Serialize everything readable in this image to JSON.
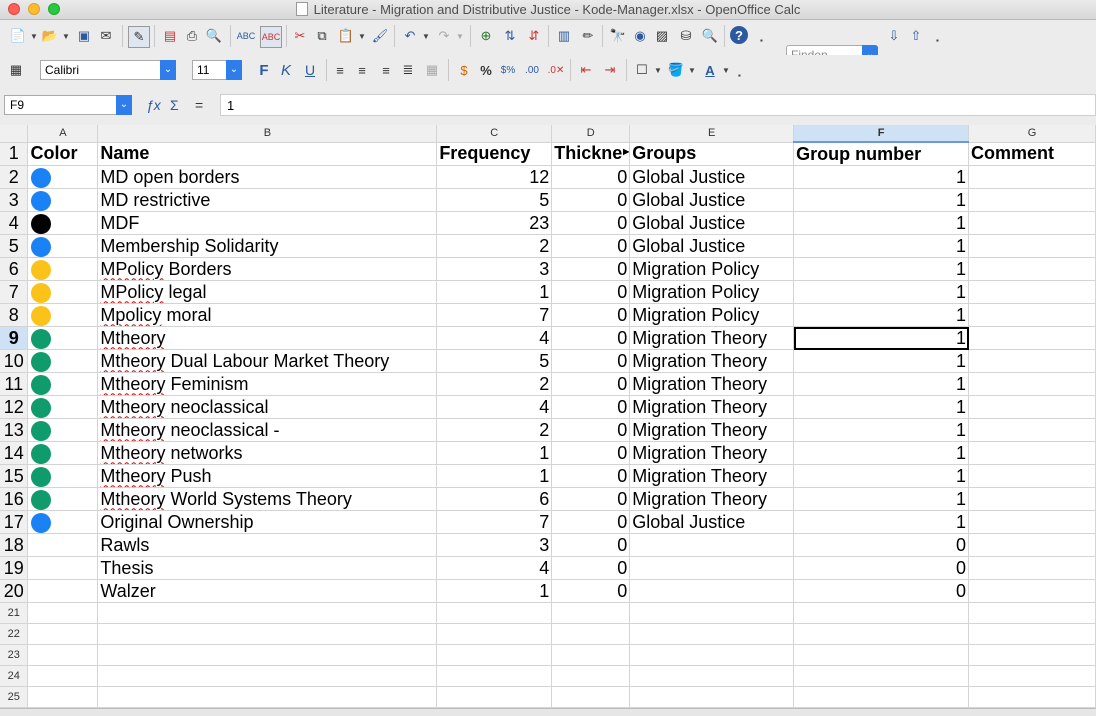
{
  "window": {
    "title": "Literature - Migration and Distributive Justice - Kode-Manager.xlsx - OpenOffice Calc"
  },
  "toolbar": {
    "find_placeholder": "Finden",
    "font_name": "Calibri",
    "font_size": "11"
  },
  "formula_bar": {
    "cell_ref": "F9",
    "content": "1"
  },
  "sheet": {
    "columns": [
      "A",
      "B",
      "C",
      "D",
      "E",
      "F",
      "G"
    ],
    "active_column": "F",
    "active_row": 9,
    "header_row": {
      "color": "Color",
      "name": "Name",
      "frequency": "Frequency",
      "thickness": "Thickne",
      "groups": "Groups",
      "group_number": "Group number",
      "comment": "Comment"
    },
    "rows": [
      {
        "row": "2",
        "color": "#1a82f5",
        "name": "MD open borders",
        "frequency": "12",
        "thickness": "0",
        "groups": "Global Justice",
        "group_number": "1"
      },
      {
        "row": "3",
        "color": "#1a82f5",
        "name": "MD restrictive",
        "frequency": "5",
        "thickness": "0",
        "groups": "Global Justice",
        "group_number": "1"
      },
      {
        "row": "4",
        "color": "#000000",
        "name": "MDF",
        "frequency": "23",
        "thickness": "0",
        "groups": "Global Justice",
        "group_number": "1"
      },
      {
        "row": "5",
        "color": "#1a82f5",
        "name": "Membership Solidarity",
        "frequency": "2",
        "thickness": "0",
        "groups": "Global Justice",
        "group_number": "1"
      },
      {
        "row": "6",
        "color": "#fbc31a",
        "name_prefix": "MPolicy",
        "name_suffix": " Borders",
        "frequency": "3",
        "thickness": "0",
        "groups": "Migration Policy",
        "group_number": "1"
      },
      {
        "row": "7",
        "color": "#fbc31a",
        "name_prefix": "MPolicy",
        "name_suffix": " legal",
        "frequency": "1",
        "thickness": "0",
        "groups": "Migration Policy",
        "group_number": "1"
      },
      {
        "row": "8",
        "color": "#fbc31a",
        "name_prefix": "Mpolicy",
        "name_suffix": " moral",
        "frequency": "7",
        "thickness": "0",
        "groups": "Migration Policy",
        "group_number": "1"
      },
      {
        "row": "9",
        "color": "#0f9b6b",
        "name_prefix": "Mtheory",
        "name_suffix": "",
        "frequency": "4",
        "thickness": "0",
        "groups": "Migration Theory",
        "group_number": "1"
      },
      {
        "row": "10",
        "color": "#0f9b6b",
        "name_prefix": "Mtheory",
        "name_suffix": " Dual Labour Market Theory",
        "frequency": "5",
        "thickness": "0",
        "groups": "Migration Theory",
        "group_number": "1"
      },
      {
        "row": "11",
        "color": "#0f9b6b",
        "name_prefix": "Mtheory",
        "name_suffix": " Feminism",
        "frequency": "2",
        "thickness": "0",
        "groups": "Migration Theory",
        "group_number": "1"
      },
      {
        "row": "12",
        "color": "#0f9b6b",
        "name_prefix": "Mtheory",
        "name_suffix": " neoclassical",
        "frequency": "4",
        "thickness": "0",
        "groups": "Migration Theory",
        "group_number": "1"
      },
      {
        "row": "13",
        "color": "#0f9b6b",
        "name_prefix": "Mtheory",
        "name_suffix": " neoclassical -",
        "frequency": "2",
        "thickness": "0",
        "groups": "Migration Theory",
        "group_number": "1"
      },
      {
        "row": "14",
        "color": "#0f9b6b",
        "name_prefix": "Mtheory",
        "name_suffix": " networks",
        "frequency": "1",
        "thickness": "0",
        "groups": "Migration Theory",
        "group_number": "1"
      },
      {
        "row": "15",
        "color": "#0f9b6b",
        "name_prefix": "Mtheory",
        "name_suffix": " Push",
        "frequency": "1",
        "thickness": "0",
        "groups": "Migration Theory",
        "group_number": "1"
      },
      {
        "row": "16",
        "color": "#0f9b6b",
        "name_prefix": "Mtheory",
        "name_suffix": " World Systems Theory",
        "frequency": "6",
        "thickness": "0",
        "groups": "Migration Theory",
        "group_number": "1"
      },
      {
        "row": "17",
        "color": "#1a82f5",
        "name": "Original Ownership",
        "frequency": "7",
        "thickness": "0",
        "groups": "Global Justice",
        "group_number": "1"
      },
      {
        "row": "18",
        "color": "",
        "name": "Rawls",
        "frequency": "3",
        "thickness": "0",
        "groups": "",
        "group_number": "0"
      },
      {
        "row": "19",
        "color": "",
        "name": "Thesis",
        "frequency": "4",
        "thickness": "0",
        "groups": "",
        "group_number": "0"
      },
      {
        "row": "20",
        "color": "",
        "name": "Walzer",
        "frequency": "1",
        "thickness": "0",
        "groups": "",
        "group_number": "0"
      }
    ],
    "empty_rows": [
      "21",
      "22",
      "23",
      "24",
      "25"
    ]
  }
}
